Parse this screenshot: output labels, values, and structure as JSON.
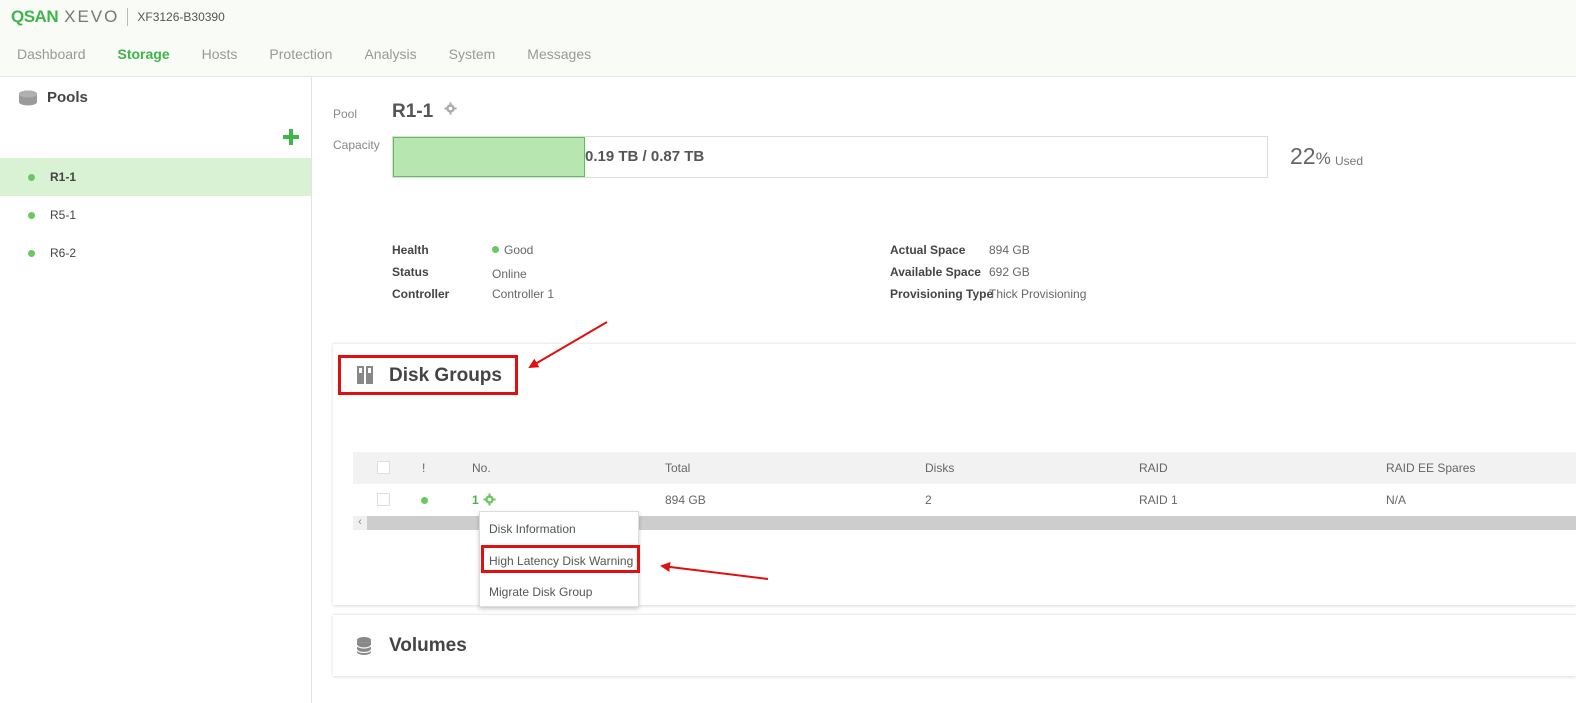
{
  "header": {
    "brand_qsan": "QSAN",
    "brand_xevo": "XEVO",
    "model": "XF3126-B30390",
    "nav": [
      {
        "label": "Dashboard",
        "active": false
      },
      {
        "label": "Storage",
        "active": true
      },
      {
        "label": "Hosts",
        "active": false
      },
      {
        "label": "Protection",
        "active": false
      },
      {
        "label": "Analysis",
        "active": false
      },
      {
        "label": "System",
        "active": false
      },
      {
        "label": "Messages",
        "active": false
      }
    ]
  },
  "sidebar": {
    "title": "Pools",
    "pools": [
      {
        "label": "R1-1",
        "selected": true
      },
      {
        "label": "R5-1",
        "selected": false
      },
      {
        "label": "R6-2",
        "selected": false
      }
    ]
  },
  "pool": {
    "label_pool": "Pool",
    "name": "R1-1",
    "label_capacity": "Capacity",
    "capacity_text": "0.19 TB / 0.87 TB",
    "used_percent": 22,
    "used_number": "22",
    "used_percent_sign": "%",
    "used_label": "Used",
    "info_left": [
      {
        "key": "Health",
        "value": "Good"
      },
      {
        "key": "Status",
        "value": "Online"
      },
      {
        "key": "Controller",
        "value": "Controller 1"
      }
    ],
    "info_right": [
      {
        "key": "Actual Space",
        "value": "894 GB"
      },
      {
        "key": "Available Space",
        "value": "692 GB"
      },
      {
        "key": "Provisioning Type",
        "value": "Thick Provisioning"
      }
    ]
  },
  "disk_groups": {
    "title": "Disk Groups",
    "columns": [
      "!",
      "No.",
      "Total",
      "Disks",
      "RAID",
      "RAID EE Spares"
    ],
    "rows": [
      {
        "no": "1",
        "total": "894 GB",
        "disks": "2",
        "raid": "RAID 1",
        "ee_spares": "N/A"
      }
    ],
    "scroll_left_glyph": "‹",
    "context_menu": [
      "Disk Information",
      "High Latency Disk Warning",
      "Migrate Disk Group"
    ]
  },
  "volumes": {
    "title": "Volumes"
  },
  "colors": {
    "accent": "#3fb54a",
    "status_good": "#69c960",
    "annotation": "#e01010",
    "selected_bg": "#d9f2d4"
  }
}
